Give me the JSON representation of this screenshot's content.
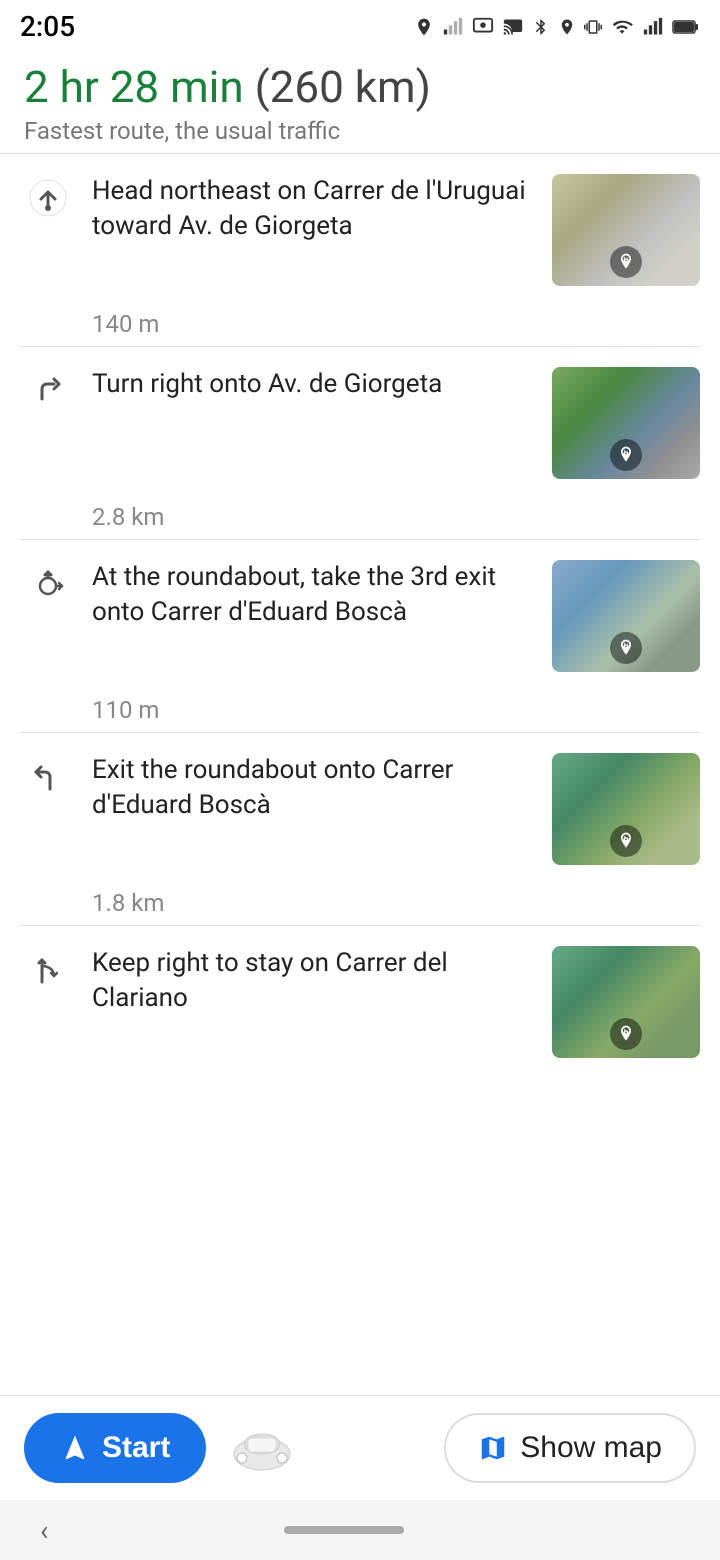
{
  "statusBar": {
    "time": "2:05",
    "icons": [
      "location",
      "signal",
      "screen-record",
      "cast",
      "bluetooth",
      "location2",
      "vibrate",
      "wifi",
      "signal-bars",
      "battery"
    ]
  },
  "header": {
    "duration": "2 hr 28 min",
    "distance": "(260 km)",
    "subtitle": "Fastest route, the usual traffic"
  },
  "steps": [
    {
      "id": 0,
      "icon": "up-arrow",
      "instruction": "Head northeast on Carrer de l'Uruguai toward Av. de Giorgeta",
      "distance": "140 m",
      "imgClass": "img-top"
    },
    {
      "id": 1,
      "icon": "turn-right",
      "instruction": "Turn right onto Av. de Giorgeta",
      "distance": "2.8 km",
      "imgClass": "img-2"
    },
    {
      "id": 2,
      "icon": "roundabout",
      "instruction": "At the roundabout, take the 3rd exit onto Carrer d'Eduard Boscà",
      "distance": "110 m",
      "imgClass": "img-3"
    },
    {
      "id": 3,
      "icon": "exit-roundabout",
      "instruction": "Exit the roundabout onto Carrer d'Eduard Boscà",
      "distance": "1.8 km",
      "imgClass": "img-4"
    },
    {
      "id": 4,
      "icon": "keep-right",
      "instruction": "Keep right to stay on Carrer del Clariano",
      "distance": "",
      "imgClass": "img-5"
    }
  ],
  "bottomBar": {
    "startLabel": "Start",
    "showMapLabel": "Show map"
  }
}
